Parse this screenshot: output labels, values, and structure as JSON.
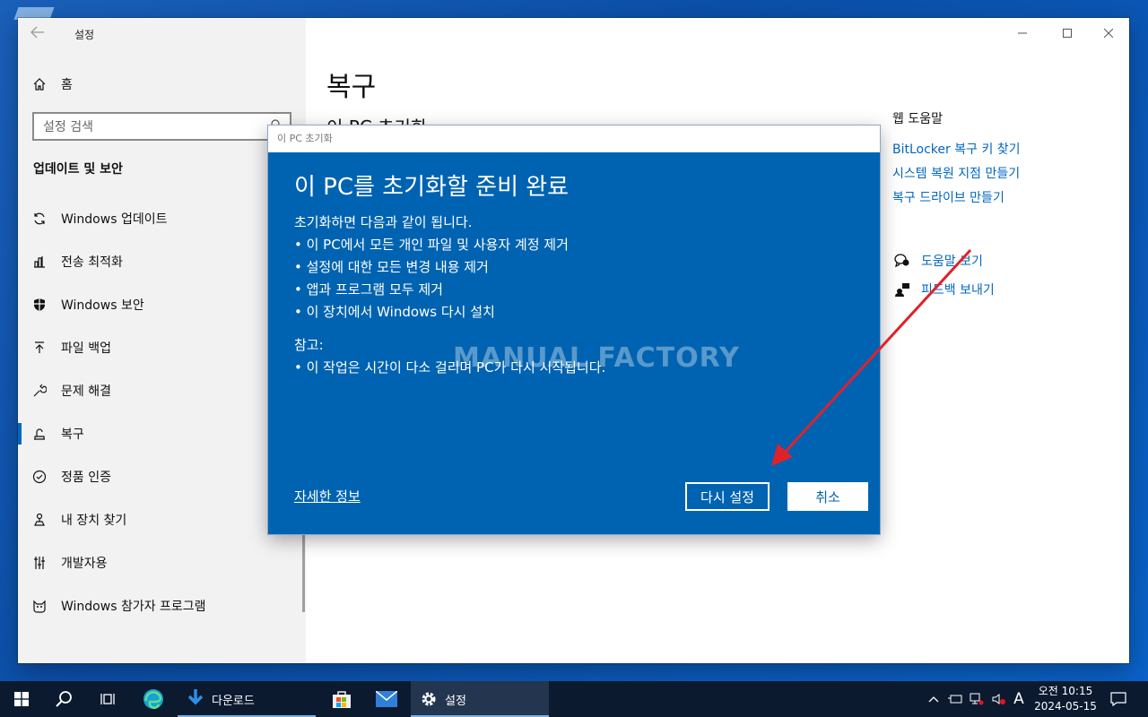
{
  "window": {
    "title": "설정",
    "main_title": "복구",
    "sub_title": "이 PC 초기화"
  },
  "sidebar": {
    "home_label": "홈",
    "search_placeholder": "설정 검색",
    "section_title": "업데이트 및 보안",
    "items": [
      {
        "label": "Windows 업데이트",
        "icon": "sync-icon"
      },
      {
        "label": "전송 최적화",
        "icon": "delivery-icon"
      },
      {
        "label": "Windows 보안",
        "icon": "shield-icon"
      },
      {
        "label": "파일 백업",
        "icon": "backup-arrow-icon"
      },
      {
        "label": "문제 해결",
        "icon": "wrench-icon"
      },
      {
        "label": "복구",
        "icon": "recovery-icon",
        "active": true
      },
      {
        "label": "정품 인증",
        "icon": "check-circle-icon"
      },
      {
        "label": "내 장치 찾기",
        "icon": "find-device-icon"
      },
      {
        "label": "개발자용",
        "icon": "developer-icon"
      },
      {
        "label": "Windows 참가자 프로그램",
        "icon": "insider-cat-icon"
      }
    ]
  },
  "right_panel": {
    "web_help_title": "웹 도움말",
    "links": [
      "BitLocker 복구 키 찾기",
      "시스템 복원 지점 만들기",
      "복구 드라이브 만들기"
    ],
    "help_label": "도움말 보기",
    "feedback_label": "피드백 보내기"
  },
  "dialog": {
    "title": "이 PC 초기화",
    "heading": "이 PC를 초기화할 준비 완료",
    "intro": "초기화하면 다음과 같이 됩니다.",
    "bullets": [
      "• 이 PC에서 모든 개인 파일 및 사용자 계정 제거",
      "• 설정에 대한 모든 변경 내용 제거",
      "• 앱과 프로그램 모두 제거",
      "• 이 장치에서 Windows 다시 설치"
    ],
    "note_label": "참고:",
    "note_bullets": [
      "• 이 작업은 시간이 다소 걸리며 PC가 다시 시작됩니다."
    ],
    "more_info": "자세한 정보",
    "reset_button": "다시 설정",
    "cancel_button": "취소",
    "watermark": "MANUAL FACTORY"
  },
  "taskbar": {
    "apps": [
      {
        "label": "다운로드",
        "icon": "download-icon"
      },
      {
        "label": "설정",
        "icon": "gear-icon"
      }
    ],
    "clock_time": "오전 10:15",
    "clock_date": "2024-05-15",
    "ime_label": "A"
  },
  "colors": {
    "dialog_bg": "#0063b1",
    "link": "#0067c0",
    "taskbar": "#0c1a30"
  }
}
